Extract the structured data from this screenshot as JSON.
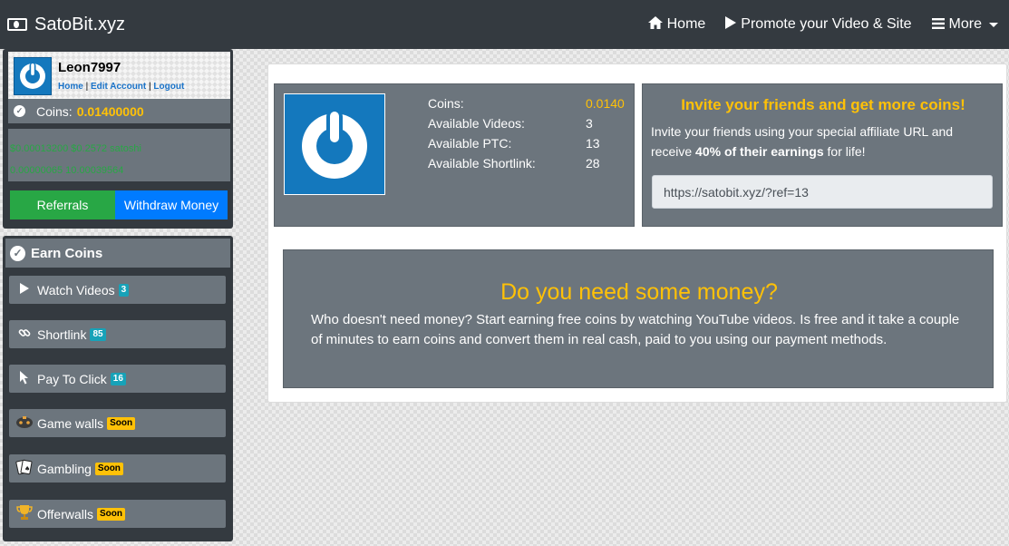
{
  "navbar": {
    "brand": "SatoBit.xyz",
    "links": [
      {
        "label": "Home",
        "icon": "home-icon"
      },
      {
        "label": "Promote your Video & Site",
        "icon": "play-icon"
      },
      {
        "label": "More",
        "icon": "menu-icon"
      }
    ]
  },
  "profile": {
    "username": "Leon7997",
    "links": [
      "Home",
      "Edit Account",
      "Logout"
    ],
    "coins_label": "Coins:",
    "coins_value": "0.01400000",
    "green_line1": "$0.00013200 $0.2572 satoshi",
    "green_line2": "0.00000065 10.00039564",
    "referrals_label": "Referrals",
    "withdraw_label": "Withdraw Money"
  },
  "earn": {
    "title": "Earn Coins",
    "items": [
      {
        "label": "Watch Videos",
        "badge": "3",
        "badge_type": "info",
        "icon": "play-icon"
      },
      {
        "label": "Shortlink",
        "badge": "85",
        "badge_type": "info",
        "icon": "link-icon"
      },
      {
        "label": "Pay To Click",
        "badge": "16",
        "badge_type": "info",
        "icon": "pointer-icon"
      },
      {
        "label": "Game walls",
        "badge": "Soon",
        "badge_type": "warning",
        "icon": "gamepad-icon"
      },
      {
        "label": "Gambling",
        "badge": "Soon",
        "badge_type": "warning",
        "icon": "cards-icon"
      },
      {
        "label": "Offerwalls",
        "badge": "Soon",
        "badge_type": "warning",
        "icon": "trophy-icon"
      }
    ]
  },
  "stats": [
    {
      "label": "Coins:",
      "value": "0.0140"
    },
    {
      "label": "Available Videos:",
      "value": "3"
    },
    {
      "label": "Available PTC:",
      "value": "13"
    },
    {
      "label": "Available Shortlink:",
      "value": "28"
    }
  ],
  "invite": {
    "title": "Invite your friends and get more coins!",
    "text_before": "Invite your friends using your special affiliate URL and receive ",
    "text_bold": "40% of their earnings",
    "text_after": " for life!",
    "ref_url": "https://satobit.xyz/?ref=13"
  },
  "money": {
    "title": "Do you need some money?",
    "text": "Who doesn't need money? Start earning free coins by watching YouTube videos. Is free and it take a couple of minutes to earn coins and convert them in real cash, paid to you using our payment methods."
  },
  "colors": {
    "navbar": "#343a40",
    "panel": "#6c757d",
    "accent_gold": "#ffc107",
    "success": "#28a745",
    "primary": "#007bff",
    "info": "#17a2b8"
  }
}
